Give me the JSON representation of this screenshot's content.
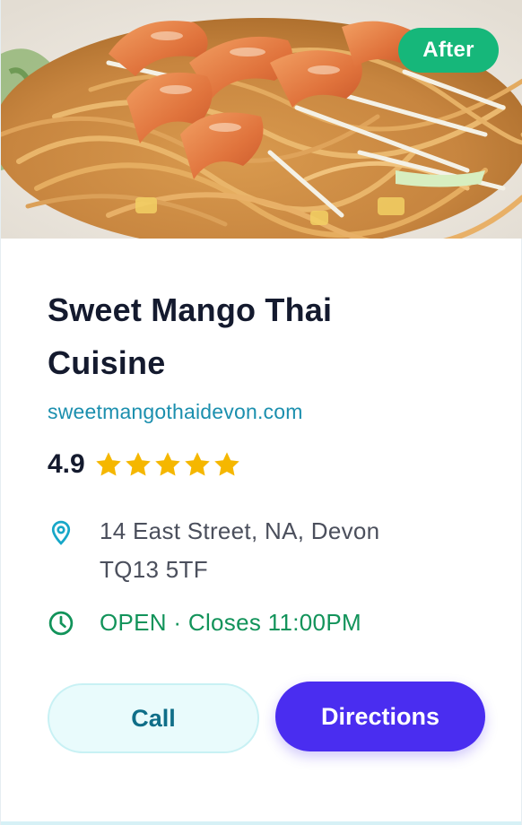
{
  "badge": {
    "label": "After"
  },
  "hero": {
    "image_subject": "shrimp pad thai noodles"
  },
  "restaurant": {
    "name": "Sweet Mango Thai Cuisine",
    "website": "sweetmangothaidevon.com",
    "rating": "4.9",
    "stars_filled": 5,
    "stars_total": 5,
    "address": "14 East Street, NA, Devon TQ13 5TF",
    "hours": "OPEN · Closes 11:00PM"
  },
  "actions": {
    "call_label": "Call",
    "directions_label": "Directions"
  },
  "icons": {
    "location": "map-pin-icon",
    "hours": "clock-icon",
    "star": "star-icon"
  },
  "colors": {
    "badge": "#16b77a",
    "link": "#1b8fae",
    "star": "#f5b700",
    "open_status": "#12935a",
    "pin": "#17a7c8",
    "call_bg": "#e9fbfc",
    "directions_bg": "#4a2df0",
    "title": "#141a2e"
  }
}
